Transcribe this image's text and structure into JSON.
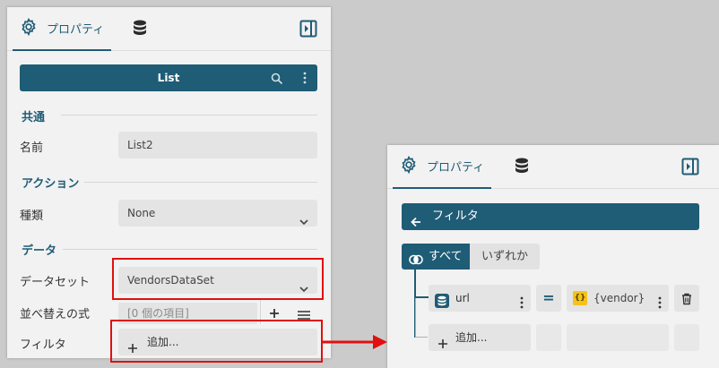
{
  "left": {
    "tabs": {
      "properties_label": "プロパティ"
    },
    "list_bar": {
      "title": "List"
    },
    "sections": {
      "common": "共通",
      "action": "アクション",
      "data": "データ"
    },
    "fields": {
      "name": {
        "label": "名前",
        "value": "List2"
      },
      "kind": {
        "label": "種類",
        "value": "None"
      },
      "dataset": {
        "label": "データセット",
        "value": "VendorsDataSet"
      },
      "sort": {
        "label": "並べ替えの式",
        "placeholder": "[0 個の項目]"
      },
      "filter": {
        "label": "フィルタ",
        "add_label": "追加..."
      }
    }
  },
  "right": {
    "tabs": {
      "properties_label": "プロパティ"
    },
    "filter_bar": {
      "title": "フィルタ"
    },
    "segments": {
      "all": "すべて",
      "any": "いずれか"
    },
    "condition": {
      "field": "url",
      "operator": "=",
      "value": "{vendor}",
      "value_badge": "{}"
    },
    "add_label": "追加..."
  },
  "colors": {
    "accent": "#1f5c76",
    "highlight": "#e01010",
    "value_badge": "#f4c21c"
  }
}
